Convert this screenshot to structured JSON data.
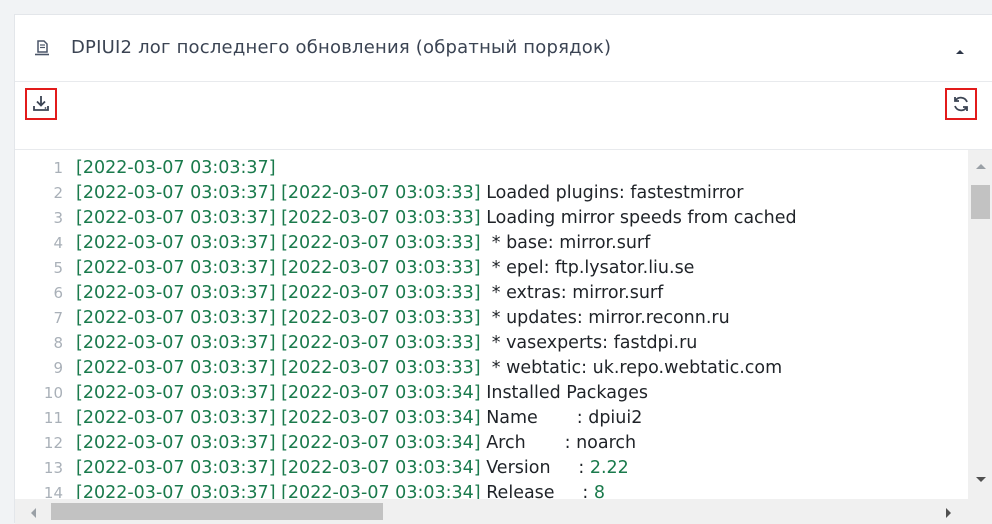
{
  "header": {
    "title": "DPIUI2 лог последнего обновления (обратный порядок)",
    "title_icon": "document-icon",
    "collapse_icon": "caret-up-icon"
  },
  "toolbar": {
    "download_icon": "download-icon",
    "refresh_icon": "refresh-icon",
    "accent_color": "#e21b1b"
  },
  "log": {
    "timestamp_color": "#1a7a4c",
    "lines": [
      {
        "num": "1",
        "ts1": "[2022-03-07 03:03:37]",
        "ts2": "",
        "text": "",
        "val": ""
      },
      {
        "num": "2",
        "ts1": "[2022-03-07 03:03:37]",
        "ts2": "[2022-03-07 03:03:33]",
        "text": "Loaded plugins: fastestmirror",
        "val": ""
      },
      {
        "num": "3",
        "ts1": "[2022-03-07 03:03:37]",
        "ts2": "[2022-03-07 03:03:33]",
        "text": "Loading mirror speeds from cached",
        "val": ""
      },
      {
        "num": "4",
        "ts1": "[2022-03-07 03:03:37]",
        "ts2": "[2022-03-07 03:03:33]",
        "text": " * base: mirror.surf",
        "val": ""
      },
      {
        "num": "5",
        "ts1": "[2022-03-07 03:03:37]",
        "ts2": "[2022-03-07 03:03:33]",
        "text": " * epel: ftp.lysator.liu.se",
        "val": ""
      },
      {
        "num": "6",
        "ts1": "[2022-03-07 03:03:37]",
        "ts2": "[2022-03-07 03:03:33]",
        "text": " * extras: mirror.surf",
        "val": ""
      },
      {
        "num": "7",
        "ts1": "[2022-03-07 03:03:37]",
        "ts2": "[2022-03-07 03:03:33]",
        "text": " * updates: mirror.reconn.ru",
        "val": ""
      },
      {
        "num": "8",
        "ts1": "[2022-03-07 03:03:37]",
        "ts2": "[2022-03-07 03:03:33]",
        "text": " * vasexperts: fastdpi.ru",
        "val": ""
      },
      {
        "num": "9",
        "ts1": "[2022-03-07 03:03:37]",
        "ts2": "[2022-03-07 03:03:33]",
        "text": " * webtatic: uk.repo.webtatic.com",
        "val": ""
      },
      {
        "num": "10",
        "ts1": "[2022-03-07 03:03:37]",
        "ts2": "[2022-03-07 03:03:34]",
        "text": "Installed Packages",
        "val": ""
      },
      {
        "num": "11",
        "ts1": "[2022-03-07 03:03:37]",
        "ts2": "[2022-03-07 03:03:34]",
        "text": "Name       : dpiui2",
        "val": ""
      },
      {
        "num": "12",
        "ts1": "[2022-03-07 03:03:37]",
        "ts2": "[2022-03-07 03:03:34]",
        "text": "Arch       : noarch",
        "val": ""
      },
      {
        "num": "13",
        "ts1": "[2022-03-07 03:03:37]",
        "ts2": "[2022-03-07 03:03:34]",
        "text": "Version     : ",
        "val": "2.22"
      },
      {
        "num": "14",
        "ts1": "[2022-03-07 03:03:37]",
        "ts2": "[2022-03-07 03:03:34]",
        "text": "Release     : ",
        "val": "8"
      }
    ]
  },
  "scrollbars": {
    "vertical_position": 0.03,
    "horizontal_position": 0.0
  }
}
